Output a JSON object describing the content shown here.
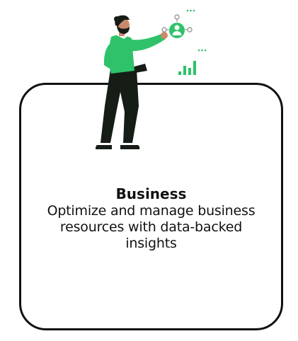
{
  "card": {
    "title": "Business",
    "description": "Optimize and manage business resources with data-backed insights"
  },
  "illustration": {
    "icons": [
      "person-with-laptop-illustration",
      "user-network-icon",
      "bar-chart-icon",
      "ellipsis-icon"
    ]
  },
  "colors": {
    "accent": "#2fc26a",
    "ink": "#111111",
    "skin": "#c98a6b",
    "background": "#ffffff"
  }
}
